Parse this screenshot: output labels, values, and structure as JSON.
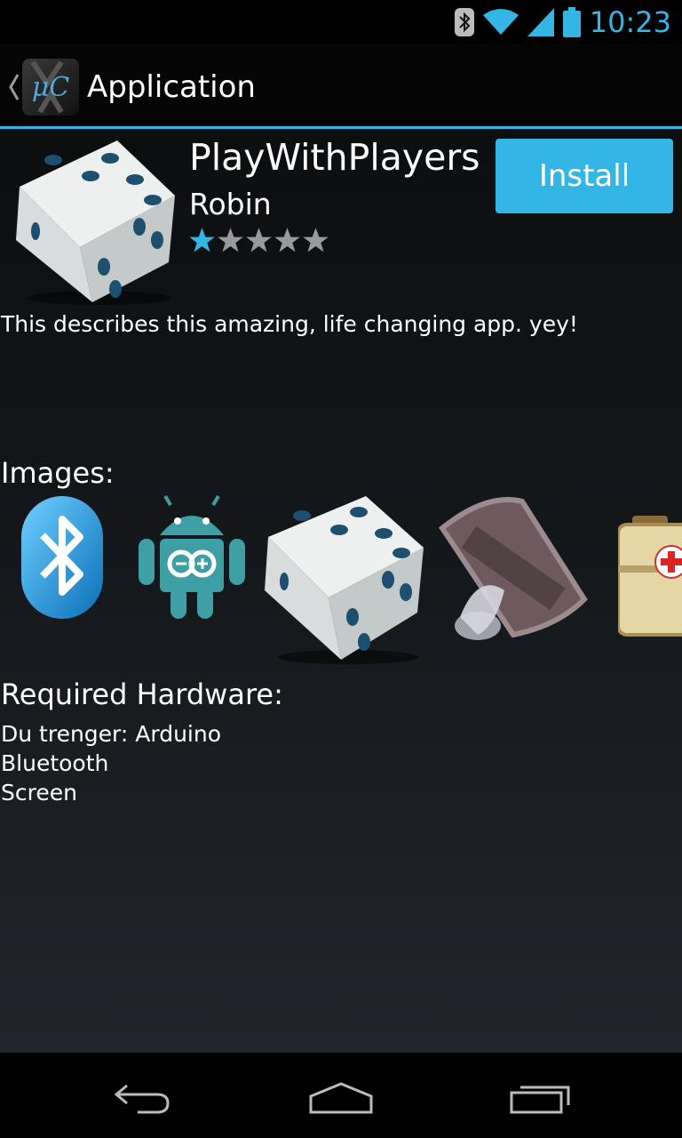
{
  "status_bar": {
    "time": "10:23",
    "icons": [
      "bluetooth-icon",
      "wifi-icon",
      "signal-icon",
      "battery-icon"
    ],
    "accent": "#33b5e5"
  },
  "action_bar": {
    "title": "Application",
    "logo_text": "μC"
  },
  "app": {
    "name": "PlayWithPlayers",
    "author": "Robin",
    "rating": {
      "value": 1,
      "max": 5
    },
    "install_label": "Install",
    "description": "This describes this amazing, life changing app. yey!"
  },
  "images": {
    "heading": "Images:",
    "items": [
      "bluetooth-icon",
      "android-arduino-icon",
      "dice-icon",
      "film-speaker-icon",
      "first-aid-kit-icon"
    ]
  },
  "hardware": {
    "heading": "Required Hardware:",
    "items": [
      "Du trenger: Arduino",
      "Bluetooth",
      "Screen"
    ]
  },
  "nav": {
    "buttons": [
      "back-icon",
      "home-icon",
      "recent-apps-icon"
    ]
  },
  "colors": {
    "accent": "#33b5e5",
    "star_on": "#33b5e5",
    "star_off": "#9a9a9a"
  }
}
